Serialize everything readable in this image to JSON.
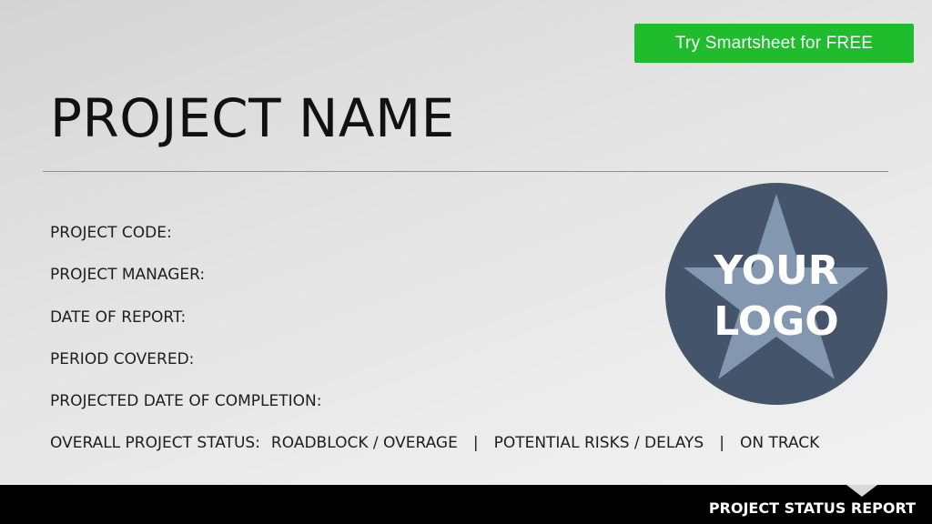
{
  "cta": {
    "label": "Try Smartsheet for FREE",
    "color": "#1fbd2e"
  },
  "header": {
    "title": "PROJECT NAME"
  },
  "fields": {
    "project_code": "PROJECT CODE:",
    "project_manager": "PROJECT MANAGER:",
    "date_of_report": "DATE OF REPORT:",
    "period_covered": "PERIOD COVERED:",
    "projected_completion": "PROJECTED DATE OF COMPLETION:"
  },
  "status": {
    "label": "OVERALL PROJECT STATUS:",
    "options": [
      "ROADBLOCK / OVERAGE",
      "POTENTIAL RISKS / DELAYS",
      "ON TRACK"
    ],
    "separator": "|"
  },
  "logo": {
    "line1": "YOUR",
    "line2": "LOGO",
    "circle_color": "#44546a",
    "star_color": "#8497b0",
    "icon": "star-icon"
  },
  "footer": {
    "label": "PROJECT STATUS REPORT"
  }
}
